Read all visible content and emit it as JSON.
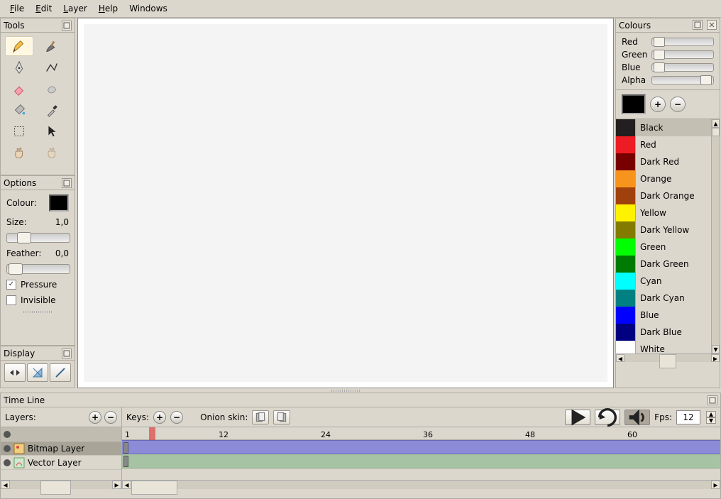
{
  "menubar": {
    "file": "File",
    "edit": "Edit",
    "layer": "Layer",
    "help": "Help",
    "windows": "Windows"
  },
  "tools": {
    "title": "Tools"
  },
  "options": {
    "title": "Options",
    "colour_label": "Colour:",
    "size_label": "Size:",
    "size_value": "1,0",
    "feather_label": "Feather:",
    "feather_value": "0,0",
    "pressure_label": "Pressure",
    "pressure_checked": true,
    "invisible_label": "Invisible",
    "invisible_checked": false
  },
  "display": {
    "title": "Display"
  },
  "colours": {
    "title": "Colours",
    "red": "Red",
    "green": "Green",
    "blue": "Blue",
    "alpha": "Alpha",
    "current": "#000000",
    "items": [
      {
        "name": "Black",
        "hex": "#231f20",
        "sel": true
      },
      {
        "name": "Red",
        "hex": "#ed1c24"
      },
      {
        "name": "Dark Red",
        "hex": "#790000"
      },
      {
        "name": "Orange",
        "hex": "#f7941d"
      },
      {
        "name": "Dark Orange",
        "hex": "#a0410d"
      },
      {
        "name": "Yellow",
        "hex": "#fff200"
      },
      {
        "name": "Dark Yellow",
        "hex": "#827b00"
      },
      {
        "name": "Green",
        "hex": "#00ff00"
      },
      {
        "name": "Dark Green",
        "hex": "#007a00"
      },
      {
        "name": "Cyan",
        "hex": "#00ffff"
      },
      {
        "name": "Dark Cyan",
        "hex": "#008080"
      },
      {
        "name": "Blue",
        "hex": "#0000ff"
      },
      {
        "name": "Dark Blue",
        "hex": "#000080"
      },
      {
        "name": "White",
        "hex": "#ffffff"
      }
    ]
  },
  "timeline": {
    "title": "Time Line",
    "layers_label": "Layers:",
    "keys_label": "Keys:",
    "onion_label": "Onion skin:",
    "fps_label": "Fps:",
    "fps_value": "12",
    "current_frame": 4,
    "ruler_marks": [
      1,
      12,
      24,
      36,
      48,
      60
    ],
    "layers": [
      {
        "name": "Bitmap Layer",
        "type": "bitmap"
      },
      {
        "name": "Vector Layer",
        "type": "vector"
      }
    ]
  }
}
